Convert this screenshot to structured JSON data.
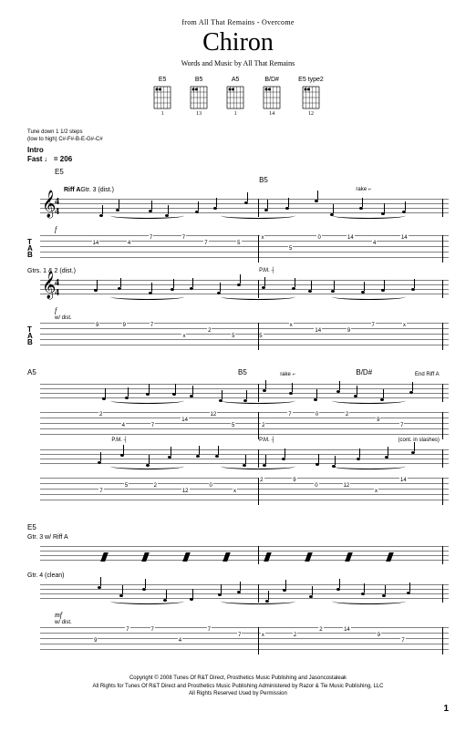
{
  "header": {
    "source": "from All That Remains - Overcome",
    "title": "Chiron",
    "credits": "Words and Music by All That Remains"
  },
  "chords": [
    {
      "name": "E5",
      "fret": "1"
    },
    {
      "name": "B5",
      "fret": "13"
    },
    {
      "name": "A5",
      "fret": "1"
    },
    {
      "name": "B/D#",
      "fret": "14"
    },
    {
      "name": "E5 type2",
      "fret": "12"
    }
  ],
  "tuning": {
    "line1": "Tune down 1 1/2 steps",
    "line2": "(low to high) C#-F#-B-E-G#-C#"
  },
  "tempo": {
    "section": "Intro",
    "marking": "Fast ♩ = 206",
    "first_chord": "E5"
  },
  "systems": [
    {
      "chord_marks": [
        {
          "txt": "B5",
          "pos": 55
        }
      ],
      "parts": [
        {
          "label": "Gtr. 3 (dist.)",
          "riff": "Riff A",
          "dynamic": "f",
          "tech": "",
          "annotations": [
            {
              "txt": "rake ⌐",
              "pos": 78
            }
          ],
          "has_tab": true
        },
        {
          "label": "Gtrs. 1 & 2 (dist.)",
          "riff": "",
          "dynamic": "f",
          "tech": "w/ dist.",
          "annotations": [
            {
              "txt": "P.M. ┤",
              "pos": 55
            }
          ],
          "has_tab": true
        }
      ]
    },
    {
      "chord_marks": [
        {
          "txt": "A5",
          "pos": 0
        },
        {
          "txt": "B5",
          "pos": 50
        },
        {
          "txt": "B/D#",
          "pos": 78
        }
      ],
      "parts": [
        {
          "label": "",
          "riff": "",
          "dynamic": "",
          "tech": "",
          "annotations": [
            {
              "txt": "rake ⌐",
              "pos": 60
            },
            {
              "txt": "End Riff A",
              "pos": 92
            }
          ],
          "has_tab": true
        },
        {
          "label": "",
          "riff": "",
          "dynamic": "",
          "tech": "",
          "annotations": [
            {
              "txt": "P.M. ┤",
              "pos": 20
            },
            {
              "txt": "P.M. ┤",
              "pos": 55
            },
            {
              "txt": "(cont. in slashes)",
              "pos": 88
            }
          ],
          "has_tab": true
        }
      ]
    },
    {
      "chord_marks": [
        {
          "txt": "E5",
          "pos": 0
        }
      ],
      "parts": [
        {
          "label": "Gtr. 3 w/ Riff A",
          "riff": "",
          "dynamic": "",
          "tech": "",
          "annotations": [],
          "has_tab": false,
          "slashes": true
        },
        {
          "label": "Gtr. 4 (clean)",
          "riff": "",
          "dynamic": "mf",
          "tech": "w/ dist.",
          "annotations": [],
          "has_tab": true
        }
      ]
    }
  ],
  "tab_label": {
    "t": "T",
    "a": "A",
    "b": "B"
  },
  "footer": {
    "line1": "Copyright © 2008 Tunes Of R&T Direct, Prosthetics Music Publishing and Jasoncostaleak",
    "line2": "All Rights for Tunes Of R&T Direct and Prosthetics Music Publishing Administered by Razor & Tie Music Publishing, LLC",
    "line3": "All Rights Reserved   Used by Permission"
  },
  "page_number": "1"
}
